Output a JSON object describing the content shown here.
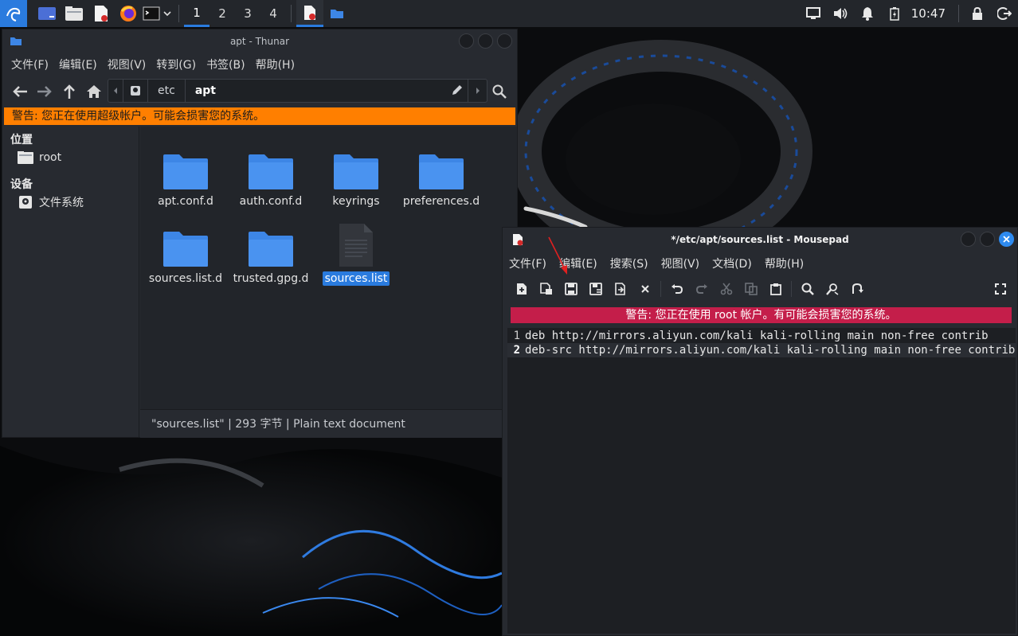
{
  "panel": {
    "workspaces": [
      "1",
      "2",
      "3",
      "4"
    ],
    "active_workspace_index": 0,
    "clock": "10:47"
  },
  "thunar": {
    "title": "apt - Thunar",
    "menu": [
      "文件(F)",
      "编辑(E)",
      "视图(V)",
      "转到(G)",
      "书签(B)",
      "帮助(H)"
    ],
    "path": [
      "etc",
      "apt"
    ],
    "warning": "警告: 您正在使用超级帐户。可能会损害您的系统。",
    "sidebar": {
      "places_header": "位置",
      "places": [
        {
          "label": "root",
          "icon": "home-folder-icon"
        }
      ],
      "devices_header": "设备",
      "devices": [
        {
          "label": "文件系统",
          "icon": "drive-icon"
        }
      ]
    },
    "files": [
      {
        "name": "apt.conf.d",
        "type": "folder"
      },
      {
        "name": "auth.conf.d",
        "type": "folder"
      },
      {
        "name": "keyrings",
        "type": "folder"
      },
      {
        "name": "preferences.d",
        "type": "folder"
      },
      {
        "name": "sources.list.d",
        "type": "folder"
      },
      {
        "name": "trusted.gpg.d",
        "type": "folder"
      },
      {
        "name": "sources.list",
        "type": "text-file",
        "selected": true
      }
    ],
    "status": "\"sources.list\" | 293 字节 | Plain text document"
  },
  "mousepad": {
    "title": "*/etc/apt/sources.list - Mousepad",
    "menu": [
      "文件(F)",
      "编辑(E)",
      "搜索(S)",
      "视图(V)",
      "文档(D)",
      "帮助(H)"
    ],
    "warning": "警告: 您正在使用 root 帐户。有可能会损害您的系统。",
    "lines": [
      {
        "num": "1",
        "text": "deb http://mirrors.aliyun.com/kali kali-rolling main non-free contrib"
      },
      {
        "num": "2",
        "text": "deb-src http://mirrors.aliyun.com/kali kali-rolling main non-free contrib"
      }
    ],
    "current_line": 2
  },
  "colors": {
    "accent": "#2a7bde",
    "folder": "#3d86e6",
    "warning_orange": "#ff7f00",
    "warning_red": "#c41e4a"
  }
}
